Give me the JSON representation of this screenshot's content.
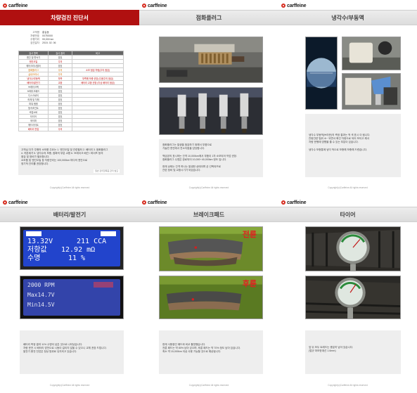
{
  "brand": "carffeine",
  "footer": "Copyright(c)Carffeine All rights reserved",
  "pages": [
    {
      "title": "차량검진 진단서",
      "vehicle_info": [
        {
          "label": "고객명",
          "value": "홍길동"
        },
        {
          "label": "차량번호",
          "value": "00가0000"
        },
        {
          "label": "주행거리",
          "value": "99,000 km"
        },
        {
          "label": "검진일자",
          "value": "2015. 02. 06"
        }
      ],
      "table": {
        "headers": [
          "검사 항목",
          "검사 결과",
          "비고"
        ],
        "rows": [
          {
            "item": "엔진 및 변속기",
            "result": "양호",
            "note": "",
            "status": "ok"
          },
          {
            "item": "엔진오일",
            "result": "주의",
            "note": "",
            "status": "warn"
          },
          {
            "item": "에어크리너필터",
            "result": "양호",
            "note": "",
            "status": "ok"
          },
          {
            "item": "점화플러그",
            "result": "주의",
            "note": "소모 점검 차량(주의 점검)",
            "status": "caution"
          },
          {
            "item": "실내크리너",
            "result": "주의",
            "note": "",
            "status": "caution"
          },
          {
            "item": "냉각수/부동액",
            "result": "부족",
            "note": "부족해 보충 권장 (다음주의 점검)",
            "status": "warn"
          },
          {
            "item": "배터리/발전기",
            "result": "교환",
            "note": "배터리 교환 권장 (이상 배터리 점검)",
            "status": "warn"
          },
          {
            "item": "브레이크액",
            "result": "양호",
            "note": "",
            "status": "ok"
          },
          {
            "item": "브레이크패드",
            "result": "양호",
            "note": "",
            "status": "ok"
          },
          {
            "item": "디스크로터",
            "result": "양호",
            "note": "",
            "status": "ok"
          },
          {
            "item": "하체 및 차체",
            "result": "양호",
            "note": "",
            "status": "ok"
          },
          {
            "item": "파워 펌핑",
            "result": "양호",
            "note": "",
            "status": "ok"
          },
          {
            "item": "등속조인트",
            "result": "양호",
            "note": "",
            "status": "ok"
          },
          {
            "item": "쇽업소버",
            "result": "양호",
            "note": "",
            "status": "ok"
          },
          {
            "item": "타이어",
            "result": "양호",
            "note": "",
            "status": "ok"
          },
          {
            "item": "와이퍼",
            "result": "양호",
            "note": "",
            "status": "ok"
          },
          {
            "item": "헤드라이트",
            "result": "양호",
            "note": "",
            "status": "ok"
          },
          {
            "item": "배터리 전압",
            "result": "주의",
            "note": "",
            "status": "warn"
          }
        ]
      },
      "summary": [
        "고객님 다가 주행의 소모품 주요는 1. 엔진오일 및 관련필터 2. 배터리 3. 점화플러그",
        "4. 카본제거 5. 냉각수의 보충, 점화의 부분 교환 6. 브레이크 배관 / 파이프 등의",
        "점검 및 정비가 필요합니다.",
        "소모품 및 엔진오일 등 차량관리는 100,000km 마다의 엔진으로",
        "정기적 관리를 권장합니다."
      ],
      "summary_more": "일반 관리항목중 관리 필요"
    },
    {
      "title": "점화플러그",
      "caption": [
        "점화플러그는 발생을 점검하기 위해서 부품으로",
        "가솔린 엔진에서 연소지점을 담당합니다.",
        "",
        "백금본의 표시하는 간격 10,000km에서 부품이 1차 소모되어 작업 권장.",
        "점화플러그 수명은 완료되어 10,000~40,000km 정도 입니다.",
        "",
        "현재 상태는 간격 하나는 발생한 상태이며 곧 선택되므로",
        "관련 정비 및 교환시기가 되었습니다."
      ]
    },
    {
      "title": "냉각수/부동액",
      "caption": [
        "냉각수 부동액(브라운)의 측정 결과는 적 색 표시 이 됩니다.",
        "잔량관련 범위 소~ 되면서 확인 차량으로 되어 보이고 해서",
        "차량 운행에 영향을 줄 수 있는 부분이 있습니다.",
        "",
        "냉각수 보충통에 냉각 적으로 보충해 보충해 드렸습니다."
      ]
    },
    {
      "title": "배터리/발전기",
      "lcd_top": {
        "voltage": "13.32V",
        "cca": "211 CCA",
        "resistance_label": "저항값",
        "resistance": "12.92 mΩ",
        "life_label": "수명",
        "life": "11 %"
      },
      "lcd_bottom": {
        "line1": "2000 RPM",
        "line2": "Max14.7V",
        "line3": "Min14.5V"
      },
      "caption": [
        "배터리 측정 결과 11% 수명이 남은 것으로 나타났습니다.",
        "차량 운전 시 배터리 방전으로 시동이 걸리지 않을 수 있으니 교체 권장 드립니다.",
        "발전기 충전 전압은 정상 범위로 유지되고 있습니다."
      ]
    },
    {
      "title": "브레이크패드",
      "label_front": "전륜",
      "label_rear": "후륜",
      "caption": [
        "현재 사용중인 패드와 비교 촬영했습니다.",
        "전륜 패드는 약 80% 남아 있으며, 후륜 패드는 약 70% 정도 남아 있습니다.",
        "최소 약 15,000km 이상 사용 가능할 것으로 예상됩니다."
      ]
    },
    {
      "title": "타이어",
      "caption": [
        "앞 뒤 모두 트레드는 충분히 남아 있습니다.",
        "(법규 마모한계선 1.6mm)"
      ]
    }
  ],
  "colors": {
    "brand_red": "#b01010",
    "warn": "#c01010",
    "caution": "#d07000",
    "lcd_blue": "#2244cc"
  }
}
